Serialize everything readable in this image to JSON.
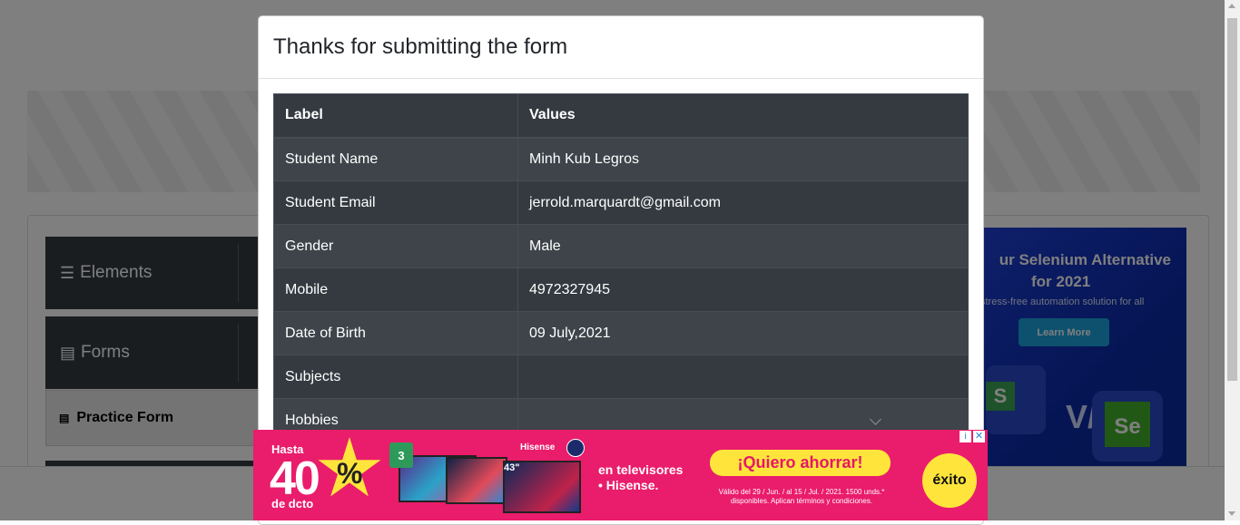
{
  "sidebar": {
    "groups": [
      {
        "label": "Elements",
        "icon": "hamburger-icon"
      },
      {
        "label": "Forms",
        "icon": "form-icon"
      }
    ],
    "active_item": {
      "label": "Practice Form",
      "icon": "form-icon"
    }
  },
  "side_ad": {
    "headline_1": "ur Selenium Alternative",
    "headline_2": "for 2021",
    "subtext": "stress-free automation solution for all",
    "button_label": "Learn More",
    "logo_left": "S",
    "vs_text": "V/s",
    "logo_right": "Se"
  },
  "modal": {
    "title": "Thanks for submitting the form",
    "table": {
      "columns": [
        "Label",
        "Values"
      ],
      "rows": [
        {
          "label": "Student Name",
          "value": "Minh Kub Legros"
        },
        {
          "label": "Student Email",
          "value": "jerrold.marquardt@gmail.com"
        },
        {
          "label": "Gender",
          "value": "Male"
        },
        {
          "label": "Mobile",
          "value": "4972327945"
        },
        {
          "label": "Date of Birth",
          "value": "09 July,2021"
        },
        {
          "label": "Subjects",
          "value": ""
        },
        {
          "label": "Hobbies",
          "value": ""
        }
      ]
    }
  },
  "bottom_ad": {
    "hasta": "Hasta",
    "percent": "40",
    "percent_sign": "%",
    "dcto": "de dcto",
    "badge": "3",
    "brand": "Hisense",
    "size": "43\"",
    "tv_text_line1": "en televisores",
    "tv_text_line2": "• Hisense.",
    "cta": "¡Quiero ahorrar!",
    "legal": "Válido del 29 / Jun. / al 15 / Jul. / 2021. 1500 unds.* disponibles. Aplican términos y condiciones.",
    "store": "éxito",
    "info_symbol": "i",
    "close_symbol": "✕"
  },
  "colors": {
    "table_bg": "#343a40",
    "table_stripe": "#3e444a",
    "ad_bg": "#ea1c6c",
    "ad_accent": "#ffe53b",
    "side_ad_bg": "#0a2aa8"
  }
}
